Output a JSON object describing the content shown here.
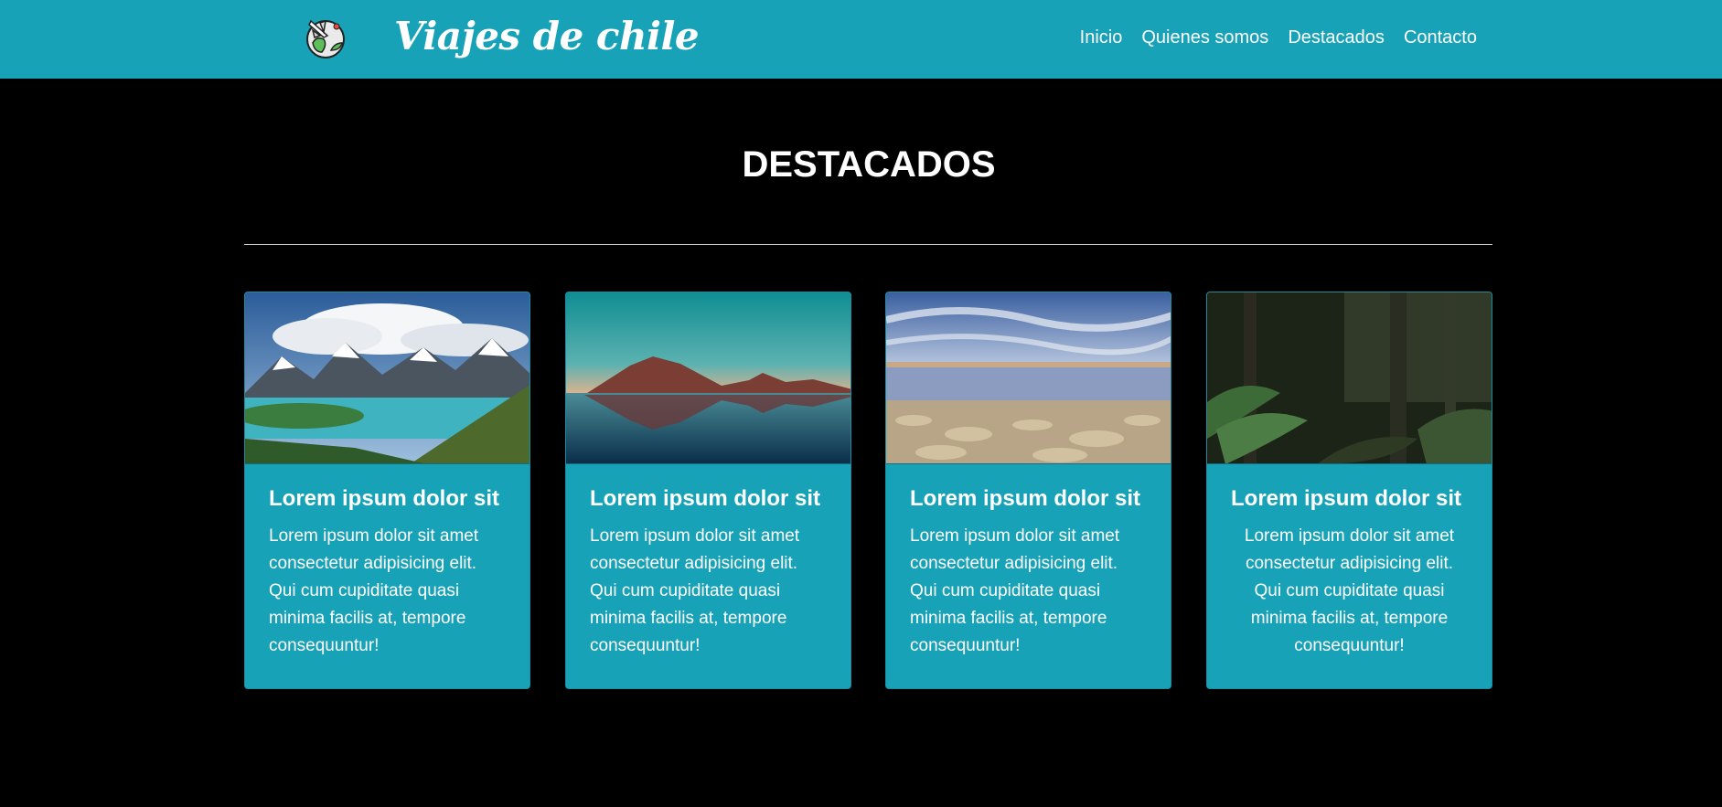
{
  "header": {
    "brand": "Viajes de chile",
    "logo_icon": "globe-airplane-icon",
    "nav": [
      "Inicio",
      "Quienes somos",
      "Destacados",
      "Contacto"
    ]
  },
  "section": {
    "title": "DESTACADOS"
  },
  "cards": [
    {
      "title": "Lorem ipsum dolor sit",
      "text": "Lorem ipsum dolor sit amet consectetur adipisicing elit. Qui cum cupiditate quasi minima facilis at, tempore consequuntur!",
      "image": "mountain-lake-image"
    },
    {
      "title": "Lorem ipsum dolor sit",
      "text": "Lorem ipsum dolor sit amet consectetur adipisicing elit. Qui cum cupiditate quasi minima facilis at, tempore consequuntur!",
      "image": "volcano-reflection-image"
    },
    {
      "title": "Lorem ipsum dolor sit",
      "text": "Lorem ipsum dolor sit amet consectetur adipisicing elit. Qui cum cupiditate quasi minima facilis at, tempore consequuntur!",
      "image": "salt-flat-lagoon-image"
    },
    {
      "title": "Lorem ipsum dolor sit",
      "text": "Lorem ipsum dolor sit amet consectetur adipisicing elit. Qui cum cupiditate quasi minima facilis at, tempore consequuntur!",
      "image": "forest-fern-image"
    }
  ],
  "colors": {
    "accent": "#17a2b8",
    "background": "#000000",
    "text": "#ffffff"
  }
}
